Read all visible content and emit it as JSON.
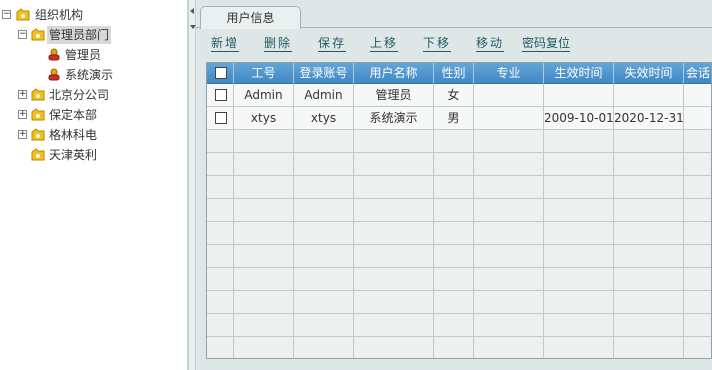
{
  "tree": {
    "nodes": [
      {
        "label": "组织机构",
        "expander": "−",
        "icon": "org-folder-icon"
      },
      {
        "label": "管理员部门",
        "expander": "−",
        "icon": "dept-folder-icon",
        "selected": true
      },
      {
        "label": "管理员",
        "icon": "user-icon"
      },
      {
        "label": "系统演示",
        "icon": "user-icon"
      },
      {
        "label": "北京分公司",
        "expander": "+",
        "icon": "dept-folder-icon"
      },
      {
        "label": "保定本部",
        "expander": "+",
        "icon": "dept-folder-icon"
      },
      {
        "label": "格林科电",
        "expander": "+",
        "icon": "dept-folder-icon"
      },
      {
        "label": "天津英利",
        "icon": "dept-folder-icon"
      }
    ]
  },
  "tabs": [
    {
      "label": "用户信息"
    }
  ],
  "toolbar": {
    "buttons": [
      "新增",
      "删除",
      "保存",
      "上移",
      "下移",
      "移动",
      "密码复位"
    ]
  },
  "table": {
    "columns": [
      "",
      "工号",
      "登录账号",
      "用户名称",
      "性别",
      "专业",
      "生效时间",
      "失效时间",
      "会话"
    ],
    "rows": [
      [
        "",
        "Admin",
        "Admin",
        "管理员",
        "女",
        "",
        "",
        "",
        ""
      ],
      [
        "",
        "xtys",
        "xtys",
        "系统演示",
        "男",
        "",
        "2009-10-01",
        "2020-12-31",
        ""
      ]
    ],
    "empty_rows": 10
  },
  "colors": {
    "header_bg": "#4a90cc",
    "link": "#1f5c61",
    "panel_bg": "#dfe7e6"
  }
}
